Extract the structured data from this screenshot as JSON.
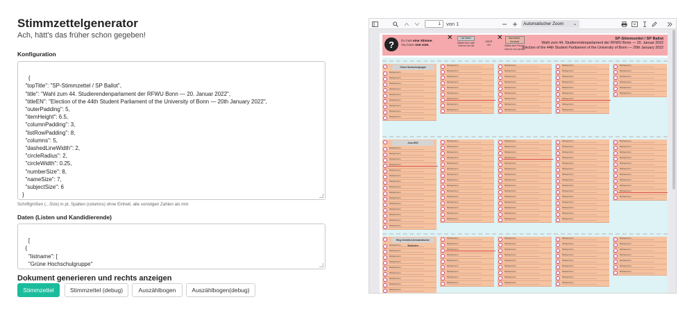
{
  "app": {
    "title": "Stimmzettelgenerator",
    "subtitle": "Ach, hätt's das früher schon gegeben!"
  },
  "config": {
    "label": "Konfiguration",
    "value": "{\n  \"topTitle\": \"SP-Stimmzettel / SP Ballot\",\n  \"title\": \"Wahl zum 44. Studierendenparlament der RFWU Bonn — 20. Januar 2022\",\n  \"titleEN\": \"Election of the 44th Student Parliament of the University of Bonn — 20th January 2022\",\n  \"outerPadding\": 5,\n  \"itemHeight\": 6.5,\n  \"columnPadding\": 3,\n  \"listRowPadding\": 8,\n  \"columns\": 5,\n  \"dashedLineWidth\": 2,\n  \"circleRadius\": 2,\n  \"circleWidth\": 0.25,\n  \"numberSize\": 8,\n  \"nameSize\": 7,\n  \"subjectSize\": 6\n}",
    "hint": "Schriftgrößen (...Size) in pt, Spalten (columns) ohne Einheit, alle sonstigen Zahlen als mm"
  },
  "data_section": {
    "label": "Daten (Listen und Kandidierende)",
    "value": "[\n  {\n    \"listname\": [\n    \"Grüne Hochschulgruppe\"\n    ],"
  },
  "generate": {
    "title": "Dokument generieren und rechts anzeigen",
    "buttons": [
      "Stimmzettel",
      "Stimmzettel (debug)",
      "Auszählbogen",
      "Auszählbogen(debug)"
    ]
  },
  "viewer": {
    "page_value": "1",
    "page_of": "von 1",
    "zoom": "Automatischer Zoom",
    "icons": [
      "sidebar-toggle-icon",
      "search-icon",
      "chevron-up-icon",
      "chevron-down-icon",
      "zoom-out-icon",
      "zoom-in-icon",
      "print-icon",
      "save-icon",
      "text-cursor-icon",
      "draw-icon",
      "more-tools-icon"
    ]
  },
  "ballot": {
    "votes_de": "Du hast ",
    "votes_de_bold": "eine Stimme.",
    "votes_en": "You have ",
    "votes_en_bold": "one vote.",
    "list_label": "List Name",
    "list_text": "Wähle eine Liste",
    "list_text_en": "Vote for one list",
    "oder": "ODER",
    "or": "OR",
    "person_label": "Nachname, Vorname",
    "person_text": "Wähle eine Person",
    "person_text_en": "Vote for one person",
    "top_title": "SP-Stimmzettel / SP Ballot",
    "title": "Wahl zum 44. Studierendenparlament der RFWU Bonn — 20. Januar 2022",
    "title_en": "Election of the 44th Student Parliament of the University of Bonn — 20th January 2022",
    "lists": [
      "Grüne Hochschulgruppe",
      "Juso-HSG",
      "Ring Christlich-Demokratischer Studenten",
      "Liste Piraten/Volt"
    ],
    "candidate": "Michael Horn",
    "colors": {
      "header": "#f5a9ad",
      "column": "#f6c3a1",
      "band": "#ddf3f6",
      "circle": "#c84a8c",
      "accent": "#1bbc9c"
    }
  }
}
